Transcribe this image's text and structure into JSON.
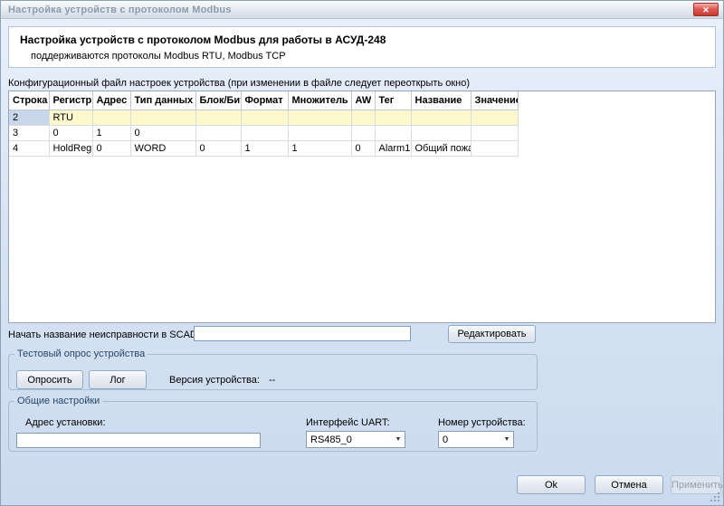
{
  "window": {
    "title": "Настройка устройств с протоколом Modbus",
    "close_label": "✕"
  },
  "header": {
    "title": "Настройка устройств с протоколом Modbus для работы в АСУД-248",
    "subtitle": "поддерживаются протоколы Modbus RTU, Modbus TCP"
  },
  "config_file_label": "Конфигурационный файл настроек устройства (при изменении в файле следует переоткрыть окно)",
  "grid": {
    "columns": [
      "Строка",
      "Регистр",
      "Адрес",
      "Тип данных",
      "Блок/Бит",
      "Формат",
      "Множитель",
      "AW",
      "Тег",
      "Название",
      "Значение"
    ],
    "rows": [
      {
        "cells": [
          "2",
          "RTU",
          "",
          "",
          "",
          "",
          "",
          "",
          "",
          "",
          ""
        ],
        "selected": true
      },
      {
        "cells": [
          "3",
          "0",
          "1",
          "0",
          "",
          "",
          "",
          "",
          "",
          "",
          ""
        ],
        "selected": false
      },
      {
        "cells": [
          "4",
          "HoldReg",
          "0",
          "WORD",
          "0",
          "1",
          "1",
          "0",
          "Alarm1",
          "Общий пожар",
          ""
        ],
        "selected": false
      }
    ]
  },
  "scada": {
    "label": "Начать название неисправности в SCADA с",
    "input_value": "",
    "edit_button": "Редактировать"
  },
  "test_group": {
    "title": "Тестовый опрос устройства",
    "poll_button": "Опросить",
    "log_button": "Лог",
    "version_label": "Версия устройства:",
    "version_value": "--"
  },
  "general_group": {
    "title": "Общие настройки",
    "address_label": "Адрес установки:",
    "address_value": "",
    "uart_label": "Интерфейс UART:",
    "uart_value": "RS485_0",
    "device_label": "Номер устройства:",
    "device_value": "0",
    "dropdown_arrow": "▼"
  },
  "footer": {
    "ok_button": "Ok",
    "cancel_button": "Отмена",
    "apply_button": "Применить"
  },
  "colors": {
    "selected_row": "#fdf8cd",
    "selected_row_header": "#c9d7ea",
    "close_button": "#d9534f",
    "window_background": "#d8e4f3",
    "group_title": "#27466b"
  }
}
